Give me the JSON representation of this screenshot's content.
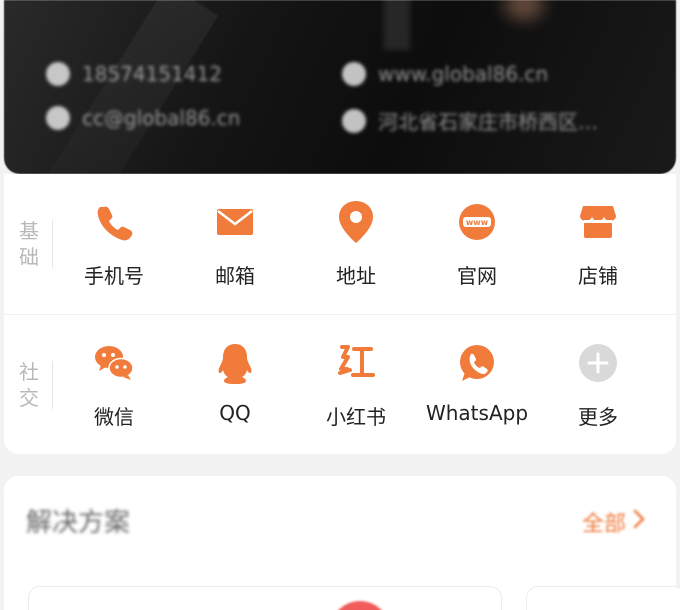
{
  "header": {
    "phone": "18574151412",
    "email": "cc@global86.cn",
    "website": "www.global86.cn",
    "address": "河北省石家庄市桥西区…"
  },
  "groups": [
    {
      "label": "基础",
      "items": [
        {
          "label": "手机号",
          "icon": "phone-icon"
        },
        {
          "label": "邮箱",
          "icon": "mail-icon"
        },
        {
          "label": "地址",
          "icon": "location-pin-icon"
        },
        {
          "label": "官网",
          "icon": "www-icon"
        },
        {
          "label": "店铺",
          "icon": "store-icon"
        }
      ]
    },
    {
      "label": "社交",
      "items": [
        {
          "label": "微信",
          "icon": "wechat-icon"
        },
        {
          "label": "QQ",
          "icon": "qq-penguin-icon"
        },
        {
          "label": "小红书",
          "icon": "xiaohongshu-icon"
        },
        {
          "label": "WhatsApp",
          "icon": "whatsapp-icon"
        },
        {
          "label": "更多",
          "icon": "plus-icon"
        }
      ]
    }
  ],
  "solutions": {
    "title": "解决方案",
    "more_label": "全部"
  },
  "colors": {
    "accent": "#f07b3b",
    "grey_icon": "#d9d9d9"
  }
}
